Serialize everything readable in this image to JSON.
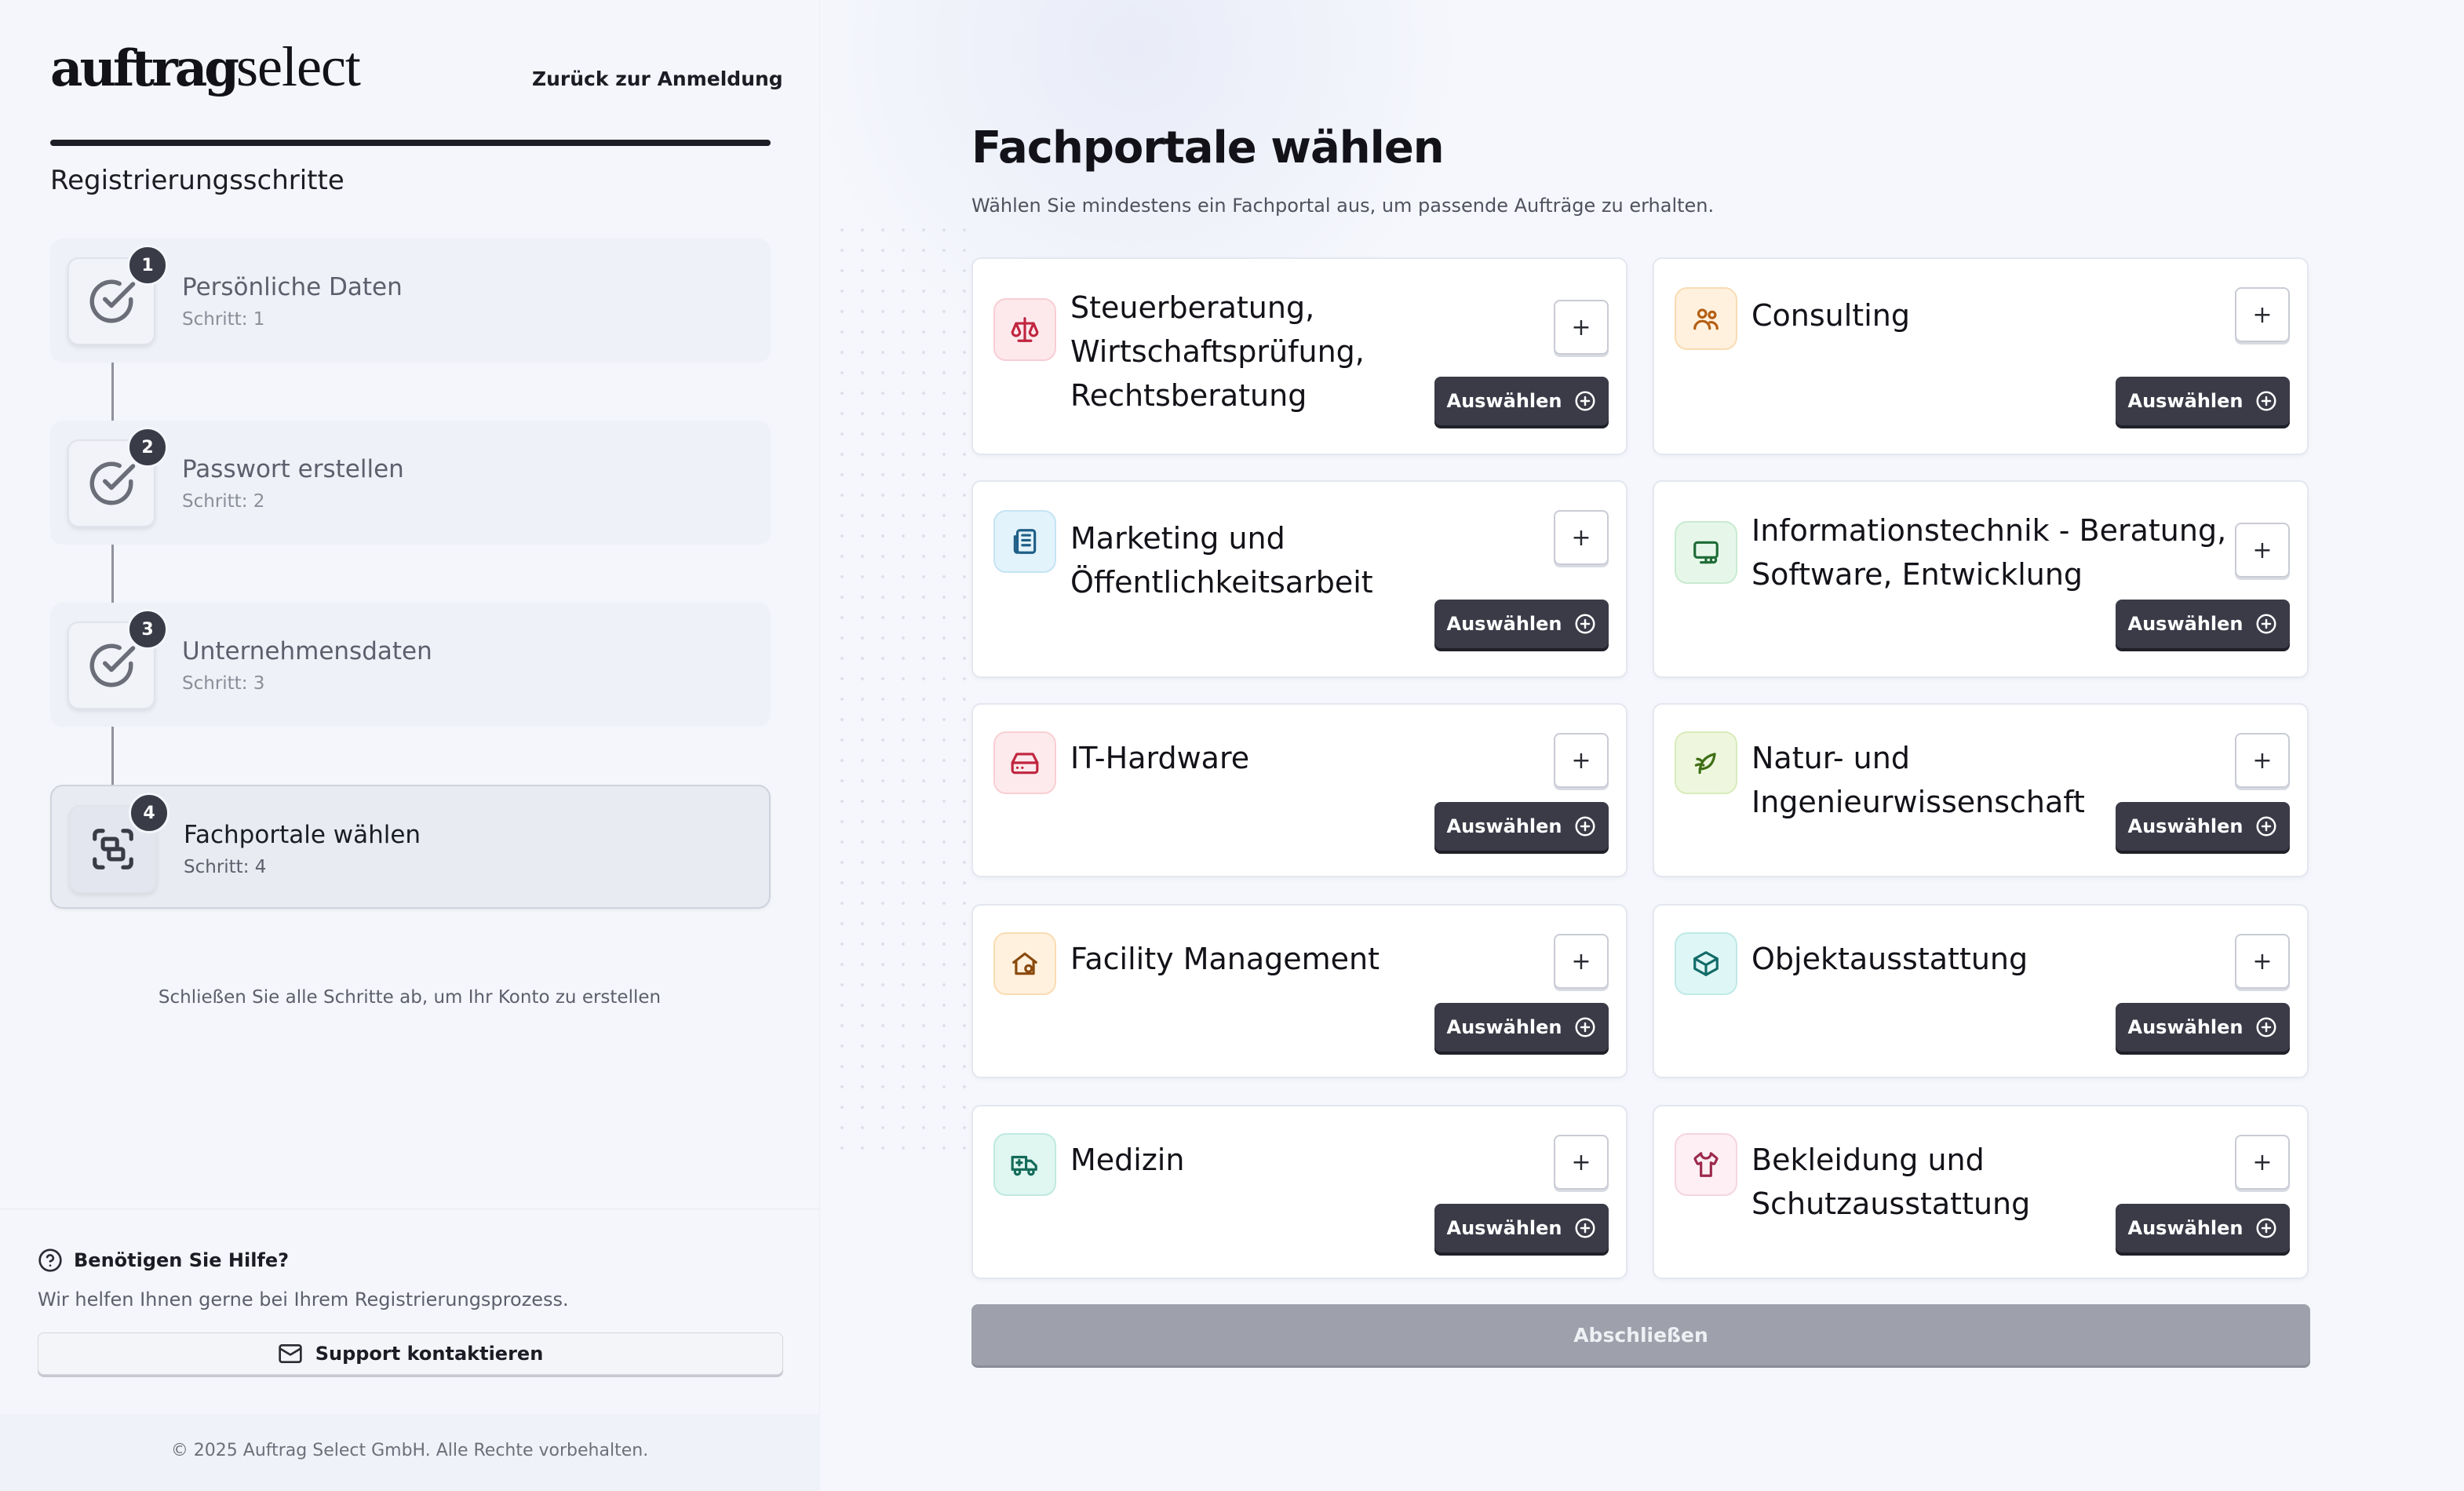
{
  "brand": {
    "bold": "auftrag",
    "light": "select"
  },
  "header": {
    "back_link": "Zurück zur Anmeldung"
  },
  "sidebar": {
    "steps_title": "Registrierungsschritte",
    "steps": [
      {
        "number": "1",
        "title": "Persönliche Daten",
        "subtitle": "Schritt: 1",
        "icon": "check-circle-icon",
        "state": "completed"
      },
      {
        "number": "2",
        "title": "Passwort erstellen",
        "subtitle": "Schritt: 2",
        "icon": "check-circle-icon",
        "state": "completed"
      },
      {
        "number": "3",
        "title": "Unternehmensdaten",
        "subtitle": "Schritt: 3",
        "icon": "check-circle-icon",
        "state": "completed"
      },
      {
        "number": "4",
        "title": "Fachportale wählen",
        "subtitle": "Schritt: 4",
        "icon": "portal-select-icon",
        "state": "active"
      }
    ],
    "hint": "Schließen Sie alle Schritte ab, um Ihr Konto zu erstellen",
    "help": {
      "title": "Benötigen Sie Hilfe?",
      "text": "Wir helfen Ihnen gerne bei Ihrem Registrierungsprozess.",
      "button": "Support kontaktieren"
    },
    "copyright": "© 2025 Auftrag Select GmbH. Alle Rechte vorbehalten."
  },
  "main": {
    "title": "Fachportale wählen",
    "subtitle": "Wählen Sie mindestens ein Fachportal aus, um passende Aufträge zu erhalten.",
    "select_label": "Auswählen",
    "plus_label": "+",
    "finish_button": "Abschließen",
    "portals": [
      {
        "label": "Steuerberatung, Wirtschaftsprüfung, Rechtsberatung",
        "icon": "scale-icon",
        "bg": "#fde9ec",
        "border": "#f8cdd5",
        "color": "#c0253f"
      },
      {
        "label": "Consulting",
        "icon": "people-icon",
        "bg": "#fff1de",
        "border": "#f9dcb3",
        "color": "#b45e12"
      },
      {
        "label": "Marketing und Öffentlichkeitsarbeit",
        "icon": "newspaper-icon",
        "bg": "#e3f3fb",
        "border": "#c5e4f3",
        "color": "#1f5f87"
      },
      {
        "label": "Informationstechnik - Beratung, Software, Entwicklung",
        "icon": "monitor-icon",
        "bg": "#e6f7ea",
        "border": "#c8ebd0",
        "color": "#1e6b36"
      },
      {
        "label": "IT-Hardware",
        "icon": "hard-drive-icon",
        "bg": "#fdeaec",
        "border": "#f8cfd4",
        "color": "#c0253f"
      },
      {
        "label": "Natur- und Ingenieurwissenschaft",
        "icon": "leaf-icon",
        "bg": "#eef7de",
        "border": "#d8ebbb",
        "color": "#3f6f15"
      },
      {
        "label": "Facility Management",
        "icon": "house-icon",
        "bg": "#fff1de",
        "border": "#f9dcb3",
        "color": "#8a4a0e"
      },
      {
        "label": "Objektausstattung",
        "icon": "package-icon",
        "bg": "#def7f6",
        "border": "#bfe9e7",
        "color": "#136b68"
      },
      {
        "label": "Medizin",
        "icon": "ambulance-icon",
        "bg": "#e0f6f1",
        "border": "#bfe9df",
        "color": "#146b5a"
      },
      {
        "label": "Bekleidung und Schutzausstattung",
        "icon": "shirt-icon",
        "bg": "#fdeff3",
        "border": "#f5d5df",
        "color": "#9c2a4d"
      }
    ]
  }
}
